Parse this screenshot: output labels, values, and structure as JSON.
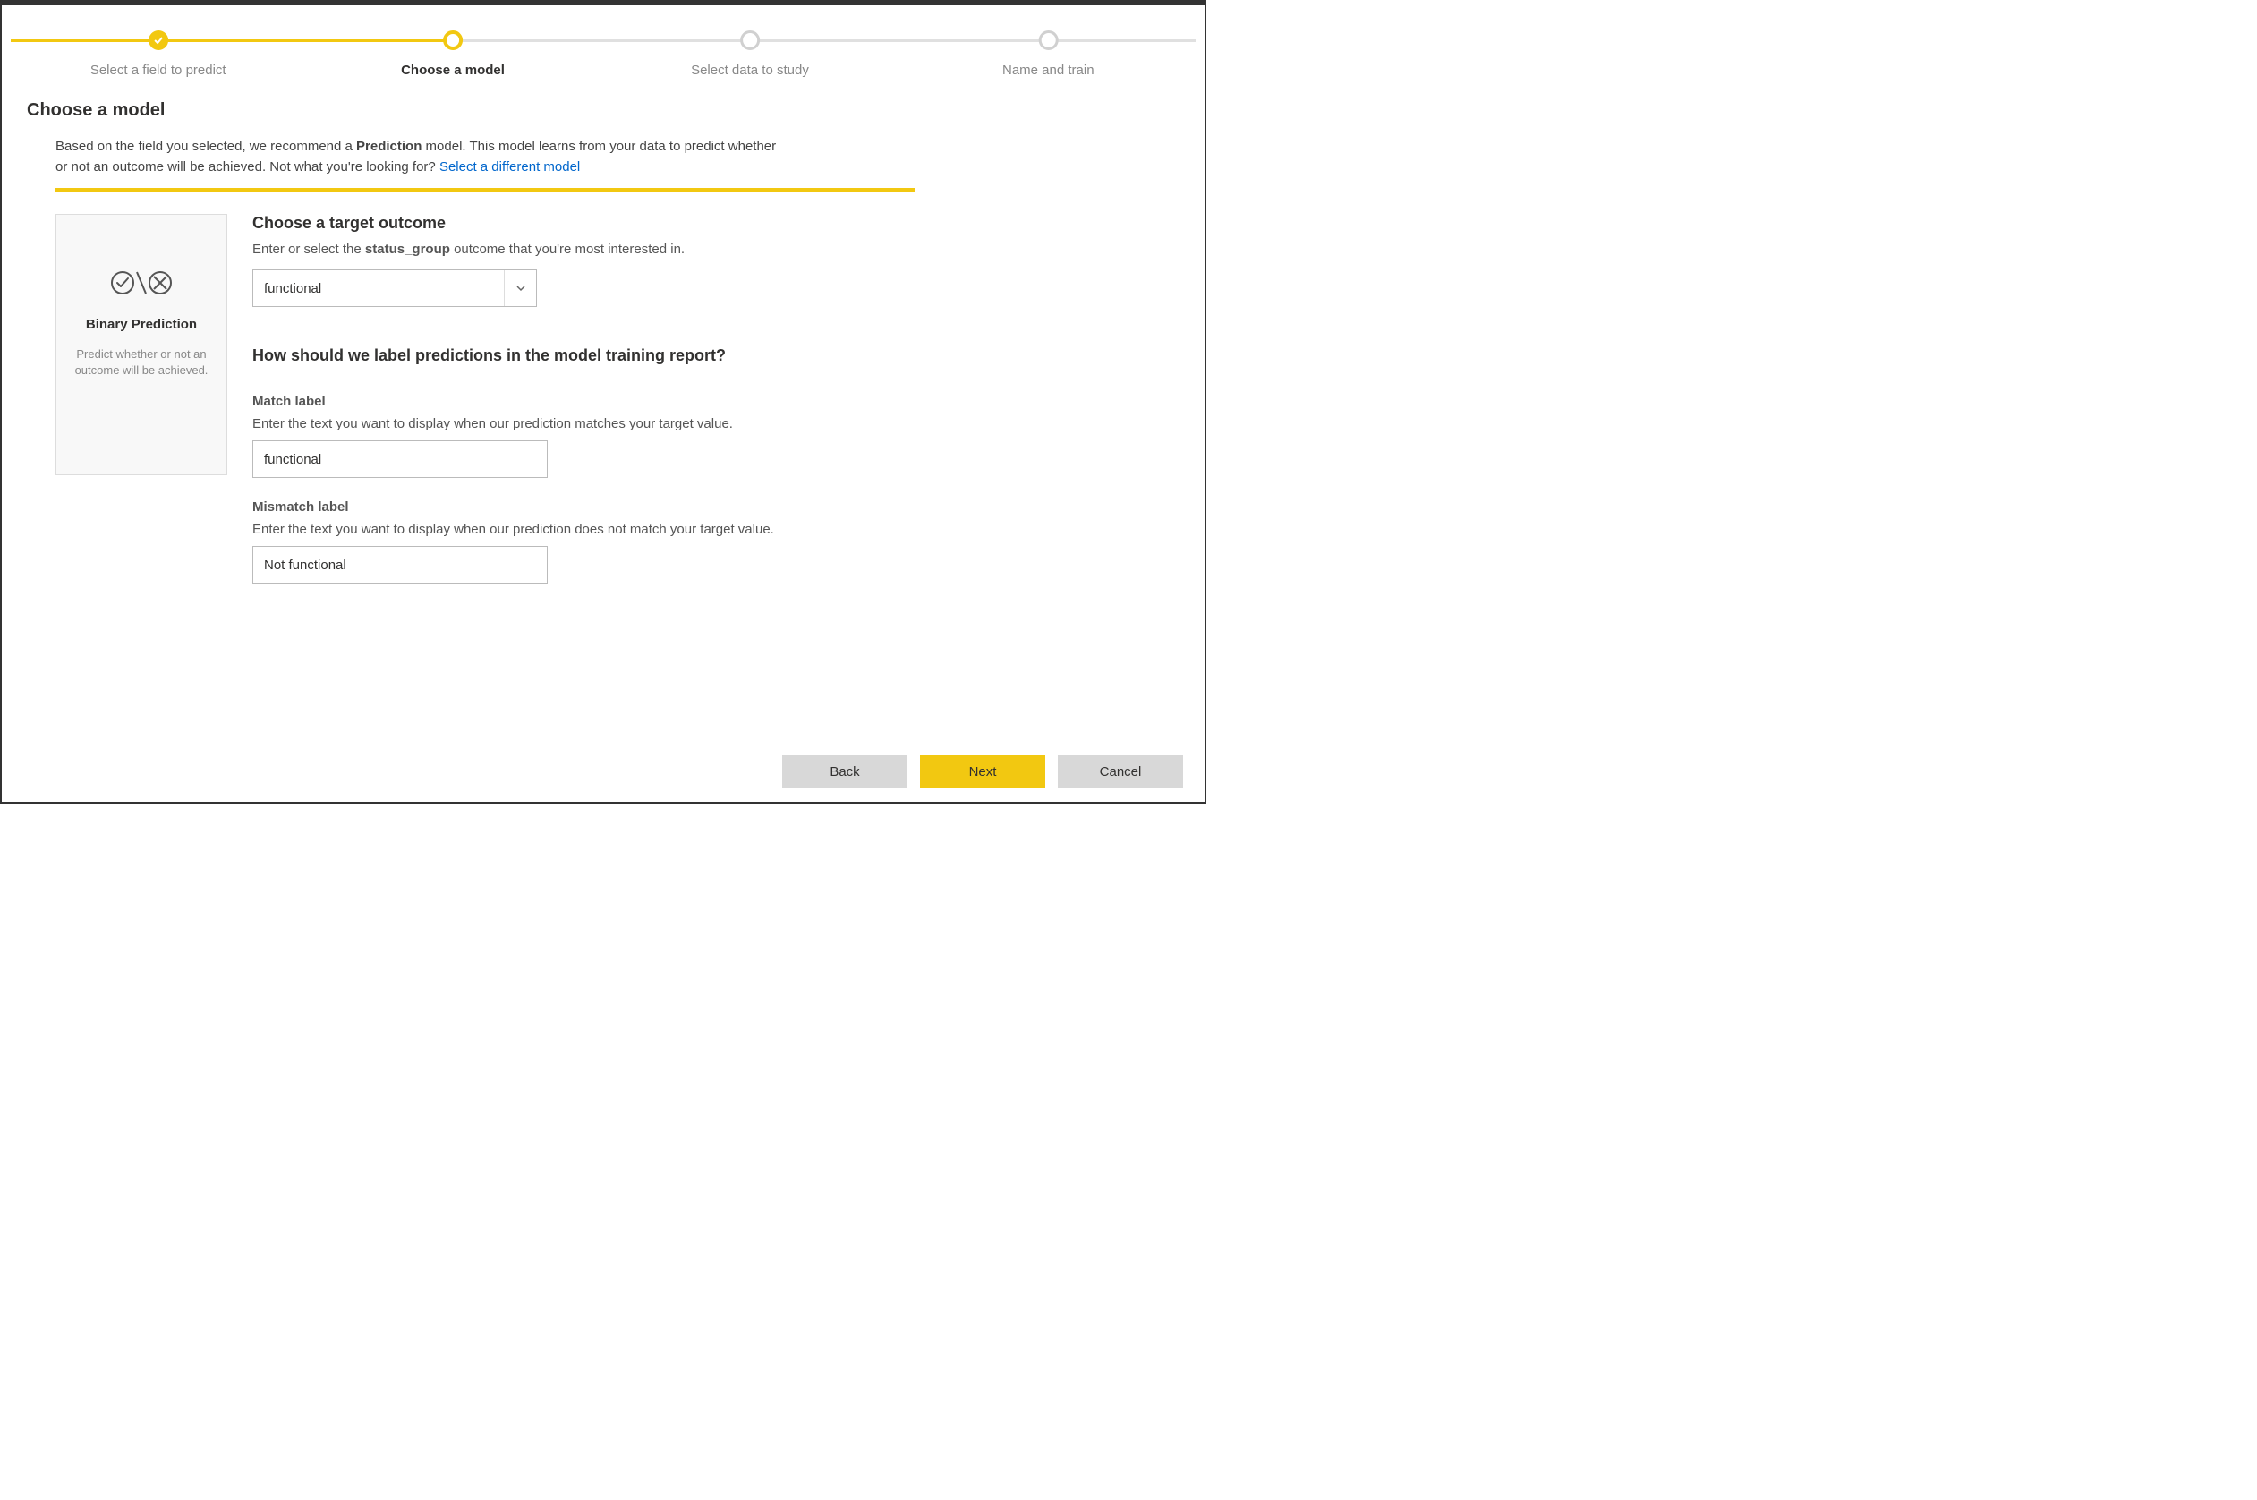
{
  "stepper": {
    "steps": [
      {
        "label": "Select a field to predict",
        "state": "completed",
        "posPct": 13
      },
      {
        "label": "Choose a model",
        "state": "current",
        "posPct": 37.5
      },
      {
        "label": "Select data to study",
        "state": "upcoming",
        "posPct": 62.2
      },
      {
        "label": "Name and train",
        "state": "upcoming",
        "posPct": 87
      }
    ],
    "activeLineWidthPct": 37.5
  },
  "pageHeading": "Choose a model",
  "intro": {
    "prefix": "Based on the field you selected, we recommend a ",
    "modelName": "Prediction",
    "mid": " model. This model learns from your data to predict whether or not an outcome will be achieved. Not what you're looking for? ",
    "linkText": "Select a different model"
  },
  "card": {
    "title": "Binary Prediction",
    "desc": "Predict whether or not an outcome will be achieved."
  },
  "target": {
    "heading": "Choose a target outcome",
    "subPrefix": "Enter or select the ",
    "fieldName": "status_group",
    "subSuffix": " outcome that you're most interested in.",
    "value": "functional"
  },
  "labels": {
    "heading": "How should we label predictions in the model training report?",
    "matchLabel": "Match label",
    "matchSub": "Enter the text you want to display when our prediction matches your target value.",
    "matchValue": "functional",
    "mismatchLabel": "Mismatch label",
    "mismatchSub": "Enter the text you want to display when our prediction does not match your target value.",
    "mismatchValue": "Not functional"
  },
  "buttons": {
    "back": "Back",
    "next": "Next",
    "cancel": "Cancel"
  }
}
